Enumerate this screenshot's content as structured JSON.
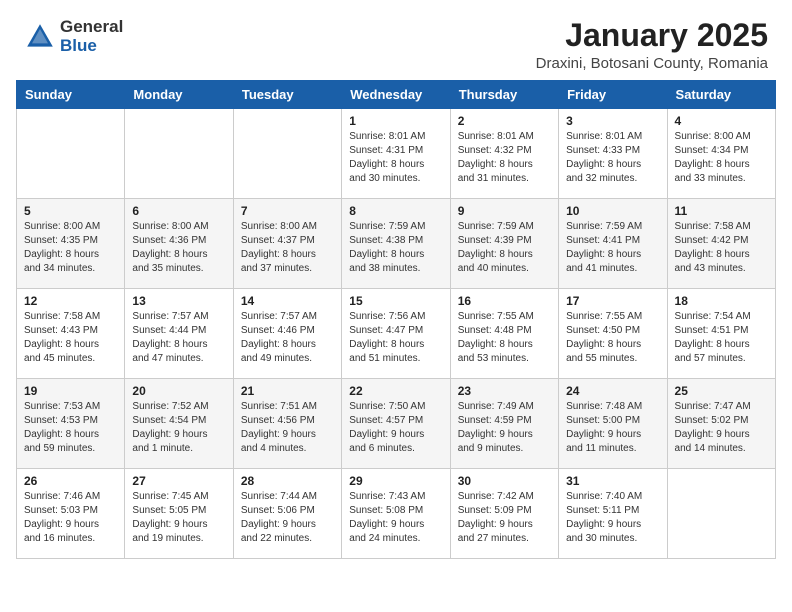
{
  "logo": {
    "general": "General",
    "blue": "Blue"
  },
  "title": "January 2025",
  "subtitle": "Draxini, Botosani County, Romania",
  "weekdays": [
    "Sunday",
    "Monday",
    "Tuesday",
    "Wednesday",
    "Thursday",
    "Friday",
    "Saturday"
  ],
  "weeks": [
    [
      {
        "day": "",
        "sunrise": "",
        "sunset": "",
        "daylight": ""
      },
      {
        "day": "",
        "sunrise": "",
        "sunset": "",
        "daylight": ""
      },
      {
        "day": "",
        "sunrise": "",
        "sunset": "",
        "daylight": ""
      },
      {
        "day": "1",
        "sunrise": "Sunrise: 8:01 AM",
        "sunset": "Sunset: 4:31 PM",
        "daylight": "Daylight: 8 hours and 30 minutes."
      },
      {
        "day": "2",
        "sunrise": "Sunrise: 8:01 AM",
        "sunset": "Sunset: 4:32 PM",
        "daylight": "Daylight: 8 hours and 31 minutes."
      },
      {
        "day": "3",
        "sunrise": "Sunrise: 8:01 AM",
        "sunset": "Sunset: 4:33 PM",
        "daylight": "Daylight: 8 hours and 32 minutes."
      },
      {
        "day": "4",
        "sunrise": "Sunrise: 8:00 AM",
        "sunset": "Sunset: 4:34 PM",
        "daylight": "Daylight: 8 hours and 33 minutes."
      }
    ],
    [
      {
        "day": "5",
        "sunrise": "Sunrise: 8:00 AM",
        "sunset": "Sunset: 4:35 PM",
        "daylight": "Daylight: 8 hours and 34 minutes."
      },
      {
        "day": "6",
        "sunrise": "Sunrise: 8:00 AM",
        "sunset": "Sunset: 4:36 PM",
        "daylight": "Daylight: 8 hours and 35 minutes."
      },
      {
        "day": "7",
        "sunrise": "Sunrise: 8:00 AM",
        "sunset": "Sunset: 4:37 PM",
        "daylight": "Daylight: 8 hours and 37 minutes."
      },
      {
        "day": "8",
        "sunrise": "Sunrise: 7:59 AM",
        "sunset": "Sunset: 4:38 PM",
        "daylight": "Daylight: 8 hours and 38 minutes."
      },
      {
        "day": "9",
        "sunrise": "Sunrise: 7:59 AM",
        "sunset": "Sunset: 4:39 PM",
        "daylight": "Daylight: 8 hours and 40 minutes."
      },
      {
        "day": "10",
        "sunrise": "Sunrise: 7:59 AM",
        "sunset": "Sunset: 4:41 PM",
        "daylight": "Daylight: 8 hours and 41 minutes."
      },
      {
        "day": "11",
        "sunrise": "Sunrise: 7:58 AM",
        "sunset": "Sunset: 4:42 PM",
        "daylight": "Daylight: 8 hours and 43 minutes."
      }
    ],
    [
      {
        "day": "12",
        "sunrise": "Sunrise: 7:58 AM",
        "sunset": "Sunset: 4:43 PM",
        "daylight": "Daylight: 8 hours and 45 minutes."
      },
      {
        "day": "13",
        "sunrise": "Sunrise: 7:57 AM",
        "sunset": "Sunset: 4:44 PM",
        "daylight": "Daylight: 8 hours and 47 minutes."
      },
      {
        "day": "14",
        "sunrise": "Sunrise: 7:57 AM",
        "sunset": "Sunset: 4:46 PM",
        "daylight": "Daylight: 8 hours and 49 minutes."
      },
      {
        "day": "15",
        "sunrise": "Sunrise: 7:56 AM",
        "sunset": "Sunset: 4:47 PM",
        "daylight": "Daylight: 8 hours and 51 minutes."
      },
      {
        "day": "16",
        "sunrise": "Sunrise: 7:55 AM",
        "sunset": "Sunset: 4:48 PM",
        "daylight": "Daylight: 8 hours and 53 minutes."
      },
      {
        "day": "17",
        "sunrise": "Sunrise: 7:55 AM",
        "sunset": "Sunset: 4:50 PM",
        "daylight": "Daylight: 8 hours and 55 minutes."
      },
      {
        "day": "18",
        "sunrise": "Sunrise: 7:54 AM",
        "sunset": "Sunset: 4:51 PM",
        "daylight": "Daylight: 8 hours and 57 minutes."
      }
    ],
    [
      {
        "day": "19",
        "sunrise": "Sunrise: 7:53 AM",
        "sunset": "Sunset: 4:53 PM",
        "daylight": "Daylight: 8 hours and 59 minutes."
      },
      {
        "day": "20",
        "sunrise": "Sunrise: 7:52 AM",
        "sunset": "Sunset: 4:54 PM",
        "daylight": "Daylight: 9 hours and 1 minute."
      },
      {
        "day": "21",
        "sunrise": "Sunrise: 7:51 AM",
        "sunset": "Sunset: 4:56 PM",
        "daylight": "Daylight: 9 hours and 4 minutes."
      },
      {
        "day": "22",
        "sunrise": "Sunrise: 7:50 AM",
        "sunset": "Sunset: 4:57 PM",
        "daylight": "Daylight: 9 hours and 6 minutes."
      },
      {
        "day": "23",
        "sunrise": "Sunrise: 7:49 AM",
        "sunset": "Sunset: 4:59 PM",
        "daylight": "Daylight: 9 hours and 9 minutes."
      },
      {
        "day": "24",
        "sunrise": "Sunrise: 7:48 AM",
        "sunset": "Sunset: 5:00 PM",
        "daylight": "Daylight: 9 hours and 11 minutes."
      },
      {
        "day": "25",
        "sunrise": "Sunrise: 7:47 AM",
        "sunset": "Sunset: 5:02 PM",
        "daylight": "Daylight: 9 hours and 14 minutes."
      }
    ],
    [
      {
        "day": "26",
        "sunrise": "Sunrise: 7:46 AM",
        "sunset": "Sunset: 5:03 PM",
        "daylight": "Daylight: 9 hours and 16 minutes."
      },
      {
        "day": "27",
        "sunrise": "Sunrise: 7:45 AM",
        "sunset": "Sunset: 5:05 PM",
        "daylight": "Daylight: 9 hours and 19 minutes."
      },
      {
        "day": "28",
        "sunrise": "Sunrise: 7:44 AM",
        "sunset": "Sunset: 5:06 PM",
        "daylight": "Daylight: 9 hours and 22 minutes."
      },
      {
        "day": "29",
        "sunrise": "Sunrise: 7:43 AM",
        "sunset": "Sunset: 5:08 PM",
        "daylight": "Daylight: 9 hours and 24 minutes."
      },
      {
        "day": "30",
        "sunrise": "Sunrise: 7:42 AM",
        "sunset": "Sunset: 5:09 PM",
        "daylight": "Daylight: 9 hours and 27 minutes."
      },
      {
        "day": "31",
        "sunrise": "Sunrise: 7:40 AM",
        "sunset": "Sunset: 5:11 PM",
        "daylight": "Daylight: 9 hours and 30 minutes."
      },
      {
        "day": "",
        "sunrise": "",
        "sunset": "",
        "daylight": ""
      }
    ]
  ]
}
